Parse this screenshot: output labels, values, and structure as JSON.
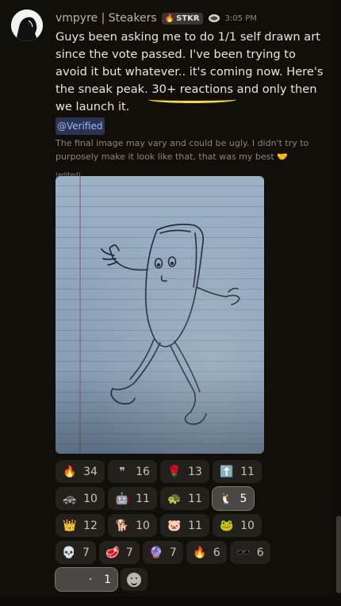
{
  "message": {
    "author": "vmpyre | Steakers",
    "tag_label": "STKR",
    "time": "3:05 PM",
    "body_part1": "Guys been asking me to do 1/1 self drawn art since the vote passed. I've been trying to avoid it but whatever.. it's coming now. Here's the sneak peak. ",
    "body_highlight": "30+ reactions",
    "body_part2": " and only then we launch it.",
    "mention": "@Verified",
    "disclaimer": "The final image may vary and could be ugly. I didn't try to purposely make it look like that, that was my best 🤝",
    "edited": "(edited)"
  },
  "colors": {
    "background": "#120f0b",
    "highlight_underline": "#f3e514",
    "mention_bg": "#2b3350",
    "mention_text": "#9fb2ff"
  },
  "reactions": [
    {
      "emoji": "🔥",
      "icon": "fire-icon",
      "count": "34"
    },
    {
      "emoji": "❞",
      "icon": "quote-icon",
      "count": "16"
    },
    {
      "emoji": "🌹",
      "icon": "rose-icon",
      "count": "13"
    },
    {
      "emoji": "⬆️",
      "icon": "this-arrow-icon",
      "count": "11"
    },
    {
      "emoji": "🚓",
      "icon": "police-icon",
      "count": "10"
    },
    {
      "emoji": "🤖",
      "icon": "bot-icon",
      "count": "11"
    },
    {
      "emoji": "🐢",
      "icon": "turtle-icon",
      "count": "11"
    },
    {
      "emoji": "🐧",
      "icon": "penguin-icon",
      "count": "5"
    },
    {
      "emoji": "👑",
      "icon": "king-icon",
      "count": "12"
    },
    {
      "emoji": "🐕",
      "icon": "doge-icon",
      "count": "10"
    },
    {
      "emoji": "🐷",
      "icon": "pig-icon",
      "count": "11"
    },
    {
      "emoji": "🐸",
      "icon": "pepe-icon",
      "count": "10"
    },
    {
      "emoji": "💀",
      "icon": "skull-icon",
      "count": "7"
    },
    {
      "emoji": "🥩",
      "icon": "steak-icon",
      "count": "7"
    },
    {
      "emoji": "🔮",
      "icon": "purple-flame-icon",
      "count": "7"
    },
    {
      "emoji": "🔥",
      "icon": "fire-wall-icon",
      "count": "6"
    },
    {
      "emoji": "🕶️",
      "icon": "sunglasses-icon",
      "count": "6"
    },
    {
      "emoji": "·",
      "icon": "dot-icon",
      "count": "1"
    }
  ]
}
